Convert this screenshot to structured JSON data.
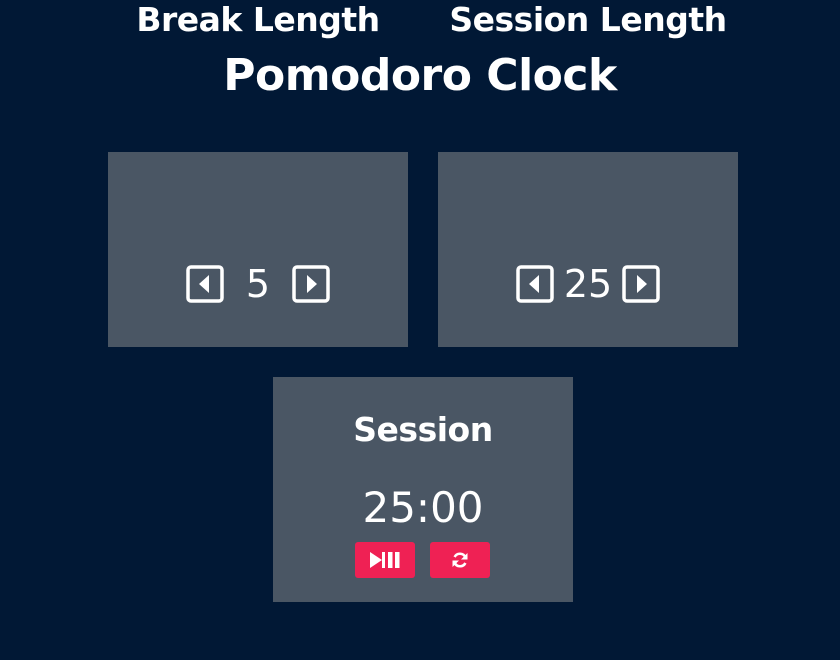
{
  "app": {
    "title": "Pomodoro Clock"
  },
  "break": {
    "label": "Break Length",
    "value": "5",
    "decrement_icon": "caret-left-square-icon",
    "increment_icon": "caret-right-square-icon"
  },
  "session": {
    "label": "Session Length",
    "value": "25",
    "decrement_icon": "caret-left-square-icon",
    "increment_icon": "caret-right-square-icon"
  },
  "timer": {
    "label": "Session",
    "time_left": "25:00",
    "start_stop_icon": "play-pause-icon",
    "reset_icon": "refresh-icon"
  },
  "colors": {
    "background": "#011835",
    "panel": "#4a5664",
    "accent": "#ef2154",
    "text": "#ffffff"
  }
}
